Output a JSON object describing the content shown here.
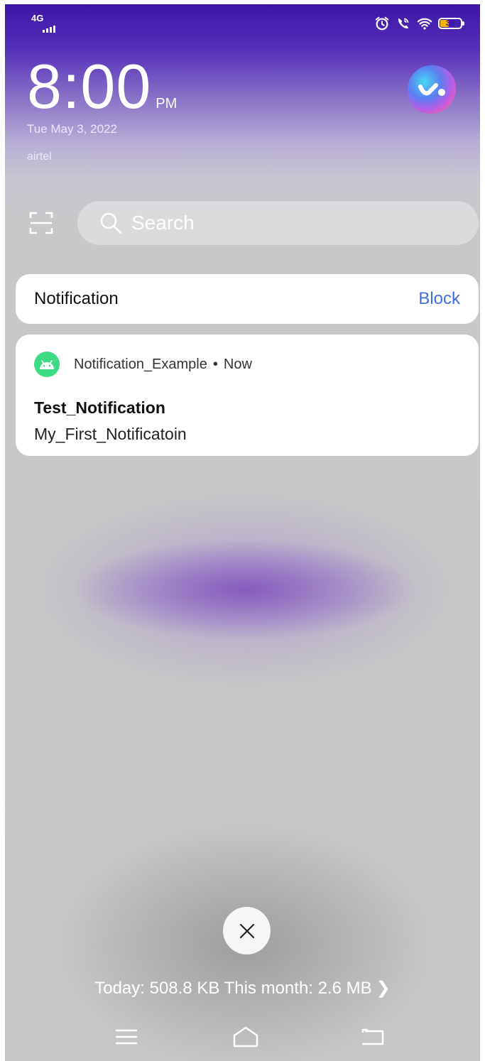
{
  "status_bar": {
    "network_label": "4G",
    "battery_level": "36",
    "icons": [
      "alarm-icon",
      "wifi-calling-icon",
      "wifi-icon",
      "battery-icon"
    ]
  },
  "clock": {
    "time": "8:00",
    "ampm": "PM",
    "date": "Tue May 3, 2022",
    "carrier": "airtel"
  },
  "search": {
    "placeholder": "Search"
  },
  "notification_header": {
    "title": "Notification",
    "action": "Block"
  },
  "notification": {
    "app_name": "Notification_Example",
    "separator": "•",
    "time": "Now",
    "title": "Test_Notification",
    "body": "My_First_Notificatoin"
  },
  "usage": {
    "text": "Today: 508.8 KB This month: 2.6 MB",
    "chevron": "❯"
  },
  "colors": {
    "accent": "#3e6fd8",
    "status_bar_bg": "#3a12a6",
    "app_icon": "#3ddc84"
  }
}
